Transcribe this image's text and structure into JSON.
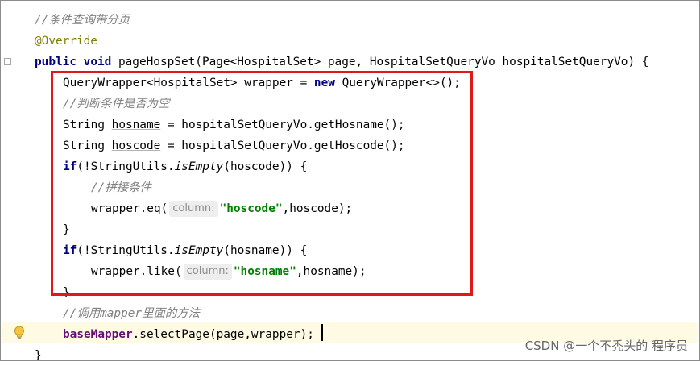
{
  "code": {
    "comment_title": "//条件查询带分页",
    "annotation": "@Override",
    "signature": {
      "kw_public": "public",
      "kw_void": "void",
      "rest": " pageHospSet(Page<HospitalSet> page, HospitalSetQueryVo hospitalSetQueryVo) {"
    },
    "line_wrapper": {
      "prefix": "QueryWrapper<HospitalSet> wrapper = ",
      "kw_new": "new",
      "suffix": " QueryWrapper<>();"
    },
    "comment_check": "//判断条件是否为空",
    "line_hosname": {
      "prefix": "String ",
      "var": "hosname",
      "suffix": " = hospitalSetQueryVo.getHosname();"
    },
    "line_hoscode": {
      "prefix": "String ",
      "var": "hoscode",
      "suffix": " = hospitalSetQueryVo.getHoscode();"
    },
    "if_hoscode": {
      "kw_if": "if",
      "prefix": "(!StringUtils.",
      "method": "isEmpty",
      "suffix": "(hoscode)) {"
    },
    "comment_concat": "//拼接条件",
    "eq_line": {
      "prefix": "wrapper.eq(",
      "hint": "column:",
      "literal": "\"hoscode\"",
      "suffix": ",hoscode);"
    },
    "close_brace_1": "}",
    "if_hosname": {
      "kw_if": "if",
      "prefix": "(!StringUtils.",
      "method": "isEmpty",
      "suffix": "(hosname)) {"
    },
    "like_line": {
      "prefix": "wrapper.like(",
      "hint": "column:",
      "literal": "\"hosname\"",
      "suffix": ",hosname);"
    },
    "close_brace_2": "}",
    "comment_mapper": "//调用mapper里面的方法",
    "select_line": {
      "field": "baseMapper",
      "suffix": ".selectPage(page,wrapper);"
    },
    "close_method": "}"
  },
  "watermark": "CSDN @一个不秃头的 程序员",
  "colors": {
    "highlight_border": "#e01818",
    "caret_row": "#fffae3",
    "keyword": "#000080",
    "comment": "#808080",
    "string": "#008000",
    "field": "#660e7a",
    "annotation": "#808000"
  }
}
